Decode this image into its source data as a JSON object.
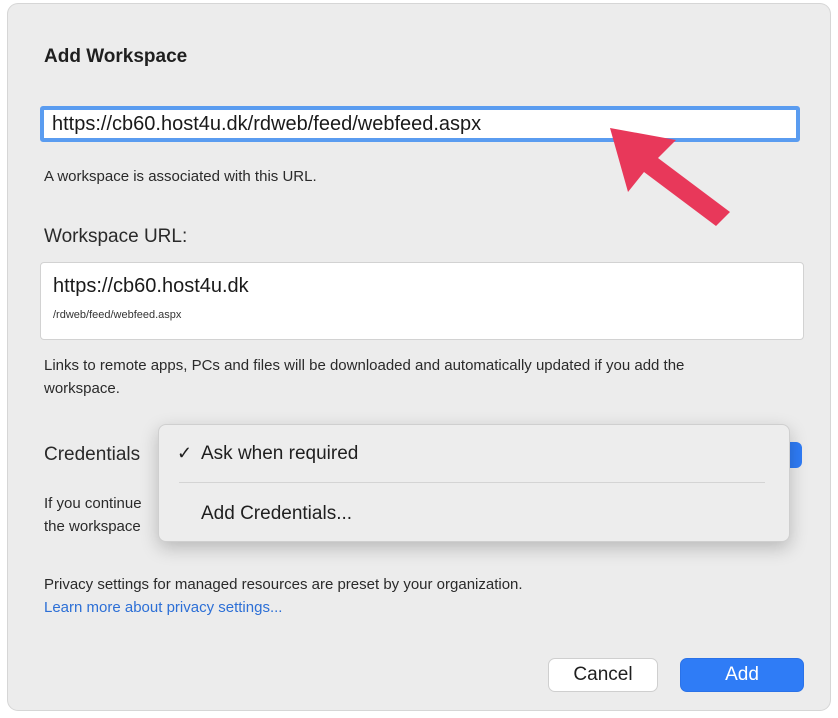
{
  "dialog": {
    "title": "Add Workspace",
    "url_input_value": "https://cb60.host4u.dk/rdweb/feed/webfeed.aspx",
    "association_text": "A workspace is associated with this URL.",
    "workspace_url_label": "Workspace URL:",
    "workspace_url_host": "https://cb60.host4u.dk",
    "workspace_url_path": "/rdweb/feed/webfeed.aspx",
    "links_text": "Links to remote apps, PCs and files will be downloaded and automatically updated if you add the workspace.",
    "credentials_label": "Credentials",
    "continue_text_line1": "If you continue",
    "continue_text_line2": "the workspace",
    "privacy_text": "Privacy settings for managed resources are preset by your organization.",
    "learn_more_link": "Learn more about privacy settings...",
    "cancel_label": "Cancel",
    "add_label": "Add"
  },
  "credentials_menu": {
    "check_glyph": "✓",
    "items": [
      {
        "label": "Ask when required",
        "selected": true
      },
      {
        "label": "Add Credentials...",
        "selected": false
      }
    ]
  },
  "annotation": {
    "icon": "red-arrow-pointer",
    "color": "#e8385a"
  },
  "colors": {
    "accent": "#2f7cf6",
    "focus_ring": "#5a9cf0",
    "link": "#2c6fd6",
    "sheet_background": "#ececec"
  }
}
